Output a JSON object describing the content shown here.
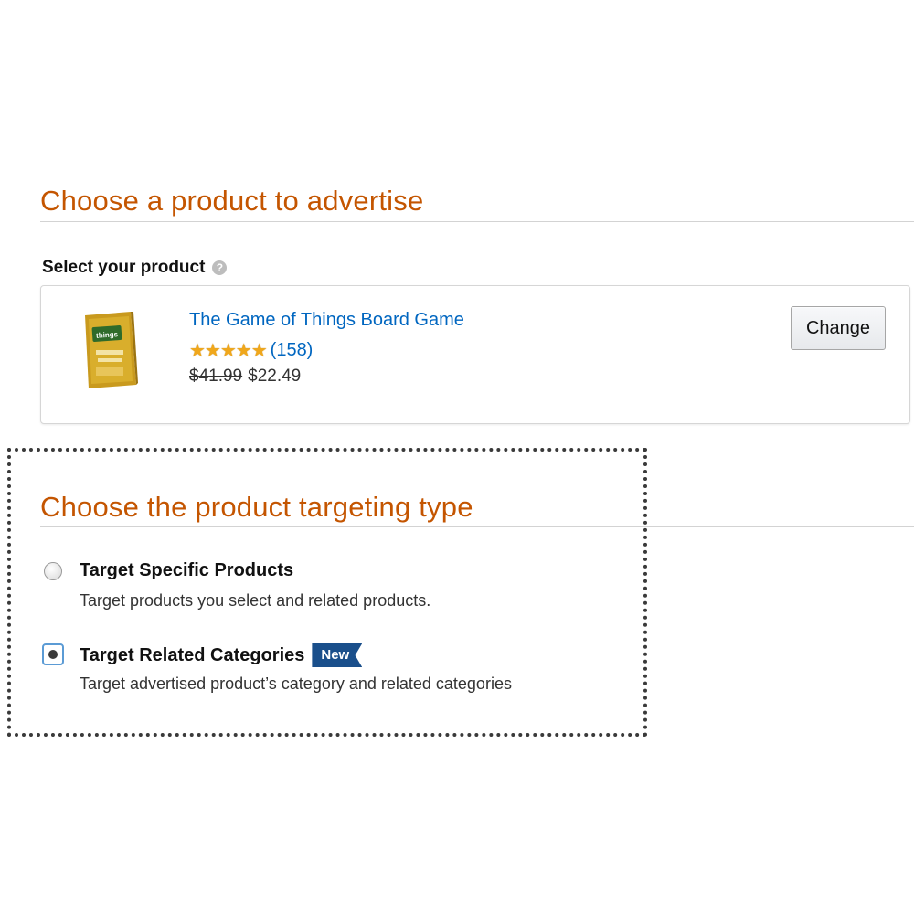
{
  "section_product": {
    "title": "Choose a product to advertise",
    "select_label": "Select your product",
    "help_icon": "?"
  },
  "product": {
    "thumbnail_icon": "board-game-box-thumbnail",
    "title": "The Game of Things Board Game",
    "stars": "★★★★★",
    "rating": 5,
    "review_count": "(158)",
    "list_price": "$41.99",
    "sale_price": "$22.49",
    "change_label": "Change"
  },
  "section_targeting": {
    "title": "Choose the product targeting type",
    "options": [
      {
        "label": "Target Specific Products",
        "description": "Target products you select and related products.",
        "selected": false
      },
      {
        "label": "Target Related Categories",
        "badge": "New",
        "description": "Target advertised product’s category and related categories",
        "selected": true
      }
    ]
  },
  "colors": {
    "heading": "#c45500",
    "link": "#0066c0",
    "badge": "#1a4f8b",
    "stars": "#f0a71b"
  }
}
